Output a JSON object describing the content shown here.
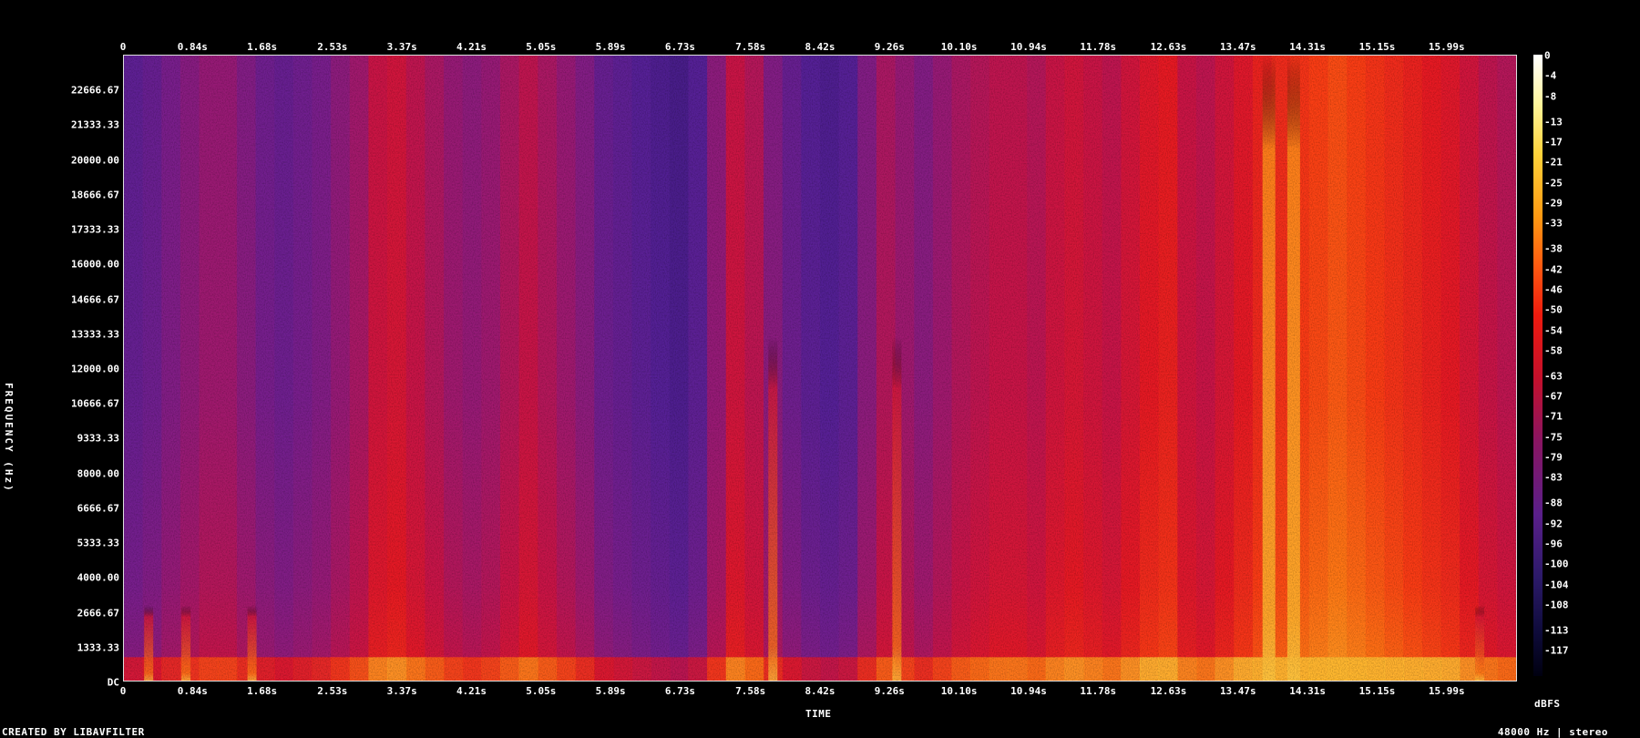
{
  "chart_data": {
    "type": "heatmap",
    "subtype": "spectrogram",
    "xlabel": "TIME",
    "ylabel": "FREQUENCY (Hz)",
    "colorbar_unit": "dBFS",
    "x_ticks": [
      "0",
      "0.84s",
      "1.68s",
      "2.53s",
      "3.37s",
      "4.21s",
      "5.05s",
      "5.89s",
      "6.73s",
      "7.58s",
      "8.42s",
      "9.26s",
      "10.10s",
      "10.94s",
      "11.78s",
      "12.63s",
      "13.47s",
      "14.31s",
      "15.15s",
      "15.99s"
    ],
    "x_tick_values": [
      0,
      0.84,
      1.68,
      2.53,
      3.37,
      4.21,
      5.05,
      5.89,
      6.73,
      7.58,
      8.42,
      9.26,
      10.1,
      10.94,
      11.78,
      12.63,
      13.47,
      14.31,
      15.15,
      15.99
    ],
    "xlim": [
      0,
      16.84
    ],
    "y_ticks": [
      "22666.67",
      "21333.33",
      "20000.00",
      "18666.67",
      "17333.33",
      "16000.00",
      "14666.67",
      "13333.33",
      "12000.00",
      "10666.67",
      "9333.33",
      "8000.00",
      "6666.67",
      "5333.33",
      "4000.00",
      "2666.67",
      "1333.33",
      "DC"
    ],
    "y_tick_values": [
      22666.67,
      21333.33,
      20000,
      18666.67,
      17333.33,
      16000,
      14666.67,
      13333.33,
      12000,
      10666.67,
      9333.33,
      8000,
      6666.67,
      5333.33,
      4000,
      2666.67,
      1333.33,
      0
    ],
    "ylim": [
      0,
      24000
    ],
    "color_ticks": [
      "0",
      "-4",
      "-8",
      "-13",
      "-17",
      "-21",
      "-25",
      "-29",
      "-33",
      "-38",
      "-42",
      "-46",
      "-50",
      "-54",
      "-58",
      "-63",
      "-67",
      "-71",
      "-75",
      "-79",
      "-83",
      "-88",
      "-92",
      "-96",
      "-100",
      "-104",
      "-108",
      "-113",
      "-117"
    ],
    "color_tick_values": [
      0,
      -4,
      -8,
      -13,
      -17,
      -21,
      -25,
      -29,
      -33,
      -38,
      -42,
      -46,
      -50,
      -54,
      -58,
      -63,
      -67,
      -71,
      -75,
      -79,
      -83,
      -88,
      -92,
      -96,
      -100,
      -104,
      -108,
      -113,
      -117
    ],
    "colorbar_range": [
      -120,
      0
    ],
    "energy_profile_dbfs": [
      -82,
      -80,
      -76,
      -73,
      -70,
      -70,
      -74,
      -78,
      -80,
      -78,
      -76,
      -72,
      -68,
      -60,
      -58,
      -62,
      -66,
      -70,
      -72,
      -70,
      -66,
      -62,
      -66,
      -70,
      -74,
      -80,
      -82,
      -84,
      -86,
      -88,
      -84,
      -72,
      -60,
      -64,
      -74,
      -80,
      -84,
      -86,
      -84,
      -74,
      -66,
      -70,
      -74,
      -70,
      -66,
      -64,
      -62,
      -62,
      -64,
      -60,
      -58,
      -60,
      -62,
      -58,
      -54,
      -52,
      -60,
      -62,
      -58,
      -54,
      -50,
      -48,
      -46,
      -44,
      -42,
      -44,
      -46,
      -48,
      -50,
      -52,
      -54,
      -58,
      -62,
      -64
    ],
    "events_time_s": [
      0.3,
      0.75,
      1.55,
      7.85,
      9.35,
      13.85,
      14.15,
      16.4
    ]
  },
  "footer": {
    "credit": "CREATED BY LIBAVFILTER",
    "sample_info": "48000 Hz | stereo"
  },
  "colors": {
    "background": "#000000",
    "axis": "#ffffff"
  }
}
